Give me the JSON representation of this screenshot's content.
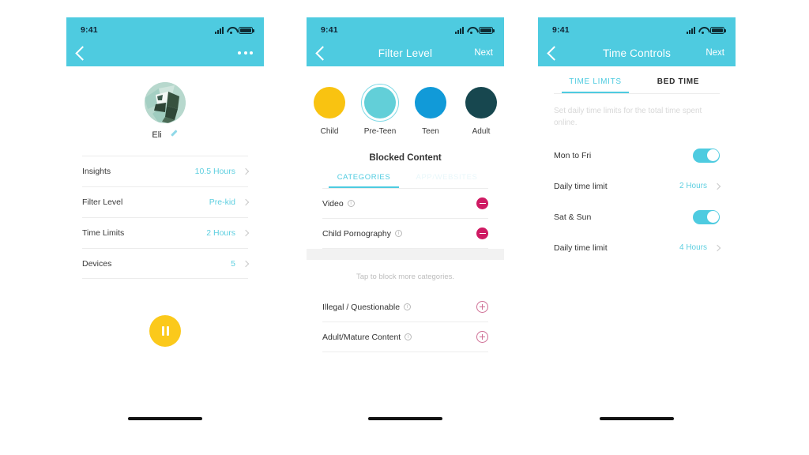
{
  "statusbar": {
    "time": "9:41"
  },
  "screen1": {
    "nav": {
      "back_icon": "chevron-left-icon",
      "more_icon": "more-horizontal-icon"
    },
    "profile": {
      "name": "Eli",
      "edit_icon": "pencil-icon",
      "avatar_alt": "panda-avatar"
    },
    "list": [
      {
        "label": "Insights",
        "value": "10.5 Hours"
      },
      {
        "label": "Filter Level",
        "value": "Pre-kid"
      },
      {
        "label": "Time Limits",
        "value": "2 Hours"
      },
      {
        "label": "Devices",
        "value": "5"
      }
    ],
    "pause_button": {
      "icon": "pause-icon",
      "color": "#fbc91b"
    }
  },
  "screen2": {
    "nav": {
      "title": "Filter Level",
      "next": "Next"
    },
    "levels": [
      {
        "label": "Child",
        "color": "#f9c311",
        "selected": false
      },
      {
        "label": "Pre-Teen",
        "color": "#62cfd8",
        "selected": true
      },
      {
        "label": "Teen",
        "color": "#119ad8",
        "selected": false
      },
      {
        "label": "Adult",
        "color": "#17474f",
        "selected": false
      }
    ],
    "blocked_title": "Blocked Content",
    "tabs": [
      {
        "label": "CATEGORIES",
        "active": true
      },
      {
        "label": "APP/WEBSITES",
        "active": false
      }
    ],
    "blocked_rows": [
      {
        "label": "Video",
        "action": "minus"
      },
      {
        "label": "Child Pornography",
        "action": "minus"
      }
    ],
    "hint": "Tap to block more categories.",
    "addable_rows": [
      {
        "label": "Illegal / Questionable",
        "action": "plus"
      },
      {
        "label": "Adult/Mature Content",
        "action": "plus"
      }
    ]
  },
  "screen3": {
    "nav": {
      "title": "Time Controls",
      "next": "Next"
    },
    "tabs": [
      {
        "label": "TIME LIMITS",
        "active": true
      },
      {
        "label": "BED TIME",
        "active": false
      }
    ],
    "description": "Set daily time limits for the total time spent online.",
    "rows": [
      {
        "label": "Mon to Fri",
        "type": "toggle",
        "value": "on"
      },
      {
        "label": "Daily time limit",
        "type": "value",
        "value": "2 Hours"
      },
      {
        "label": "Sat & Sun",
        "type": "toggle",
        "value": "on"
      },
      {
        "label": "Daily time limit",
        "type": "value",
        "value": "4 Hours"
      }
    ]
  }
}
